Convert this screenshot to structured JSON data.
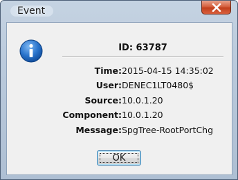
{
  "window": {
    "title": "Event",
    "close_icon": "close-x-icon",
    "info_icon": "information-icon"
  },
  "content": {
    "id_line": "ID: 63787",
    "fields": [
      {
        "label": "Time:",
        "value": "2015-04-15 14:35:02"
      },
      {
        "label": "User:",
        "value": "DENEC1LT0480$"
      },
      {
        "label": "Source:",
        "value": "10.0.1.20"
      },
      {
        "label": "Component:",
        "value": "10.0.1.20"
      },
      {
        "label": "Message:",
        "value": "SpgTree-RootPortChg"
      }
    ]
  },
  "buttons": {
    "ok_label": "OK"
  },
  "colors": {
    "close_button": "#c7451f",
    "frame": "#b9c9db",
    "info_icon": "#1f63b8"
  }
}
